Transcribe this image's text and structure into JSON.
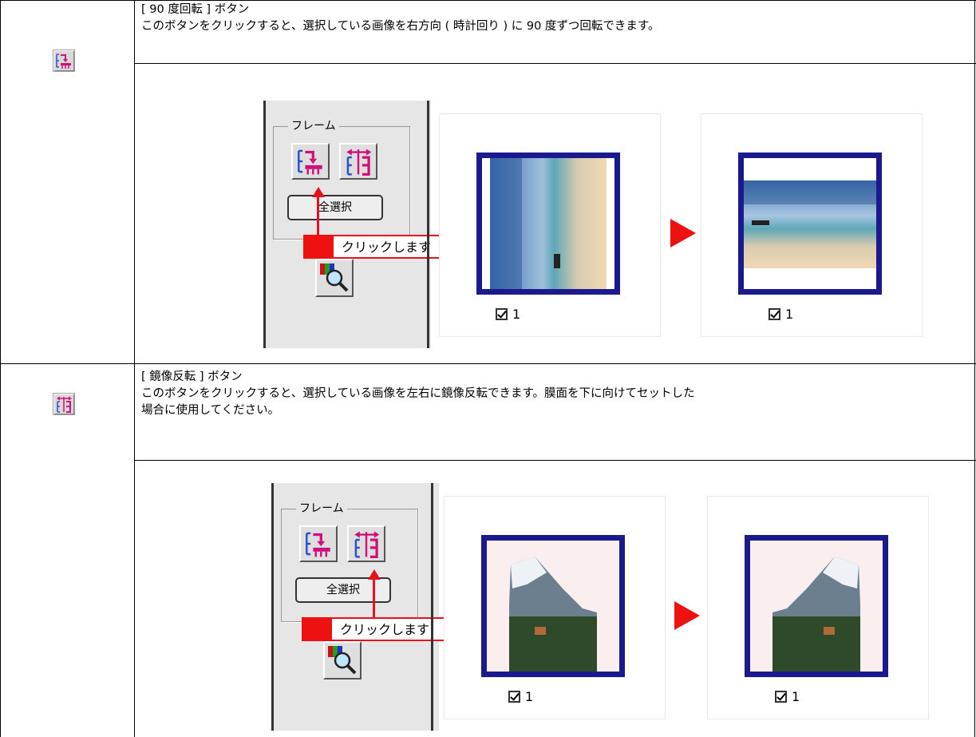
{
  "rows": [
    {
      "title": "[ 90 度回転 ] ボタン",
      "desc_lines": [
        "このボタンをクリックすると、選択している画像を右方向 ( 時計回り ) に 90 度ずつ回転できます。"
      ],
      "toolbar_icon": "rotate-90-icon",
      "illustration": {
        "panel_label": "フレーム",
        "select_all_label": "全選択",
        "callout_label": "クリックします",
        "highlighted_button": "rotate-90-button",
        "before_checkbox_number": "1",
        "after_checkbox_number": "1",
        "before_image": "portrait-beach-photo",
        "after_image": "landscape-beach-photo"
      }
    },
    {
      "title": "[ 鏡像反転 ] ボタン",
      "desc_lines": [
        "このボタンをクリックすると、選択している画像を左右に鏡像反転できます。膜面を下に向けてセットした",
        "場合に使用してください。"
      ],
      "toolbar_icon": "mirror-flip-icon",
      "illustration": {
        "panel_label": "フレーム",
        "select_all_label": "全選択",
        "callout_label": "クリックします",
        "highlighted_button": "mirror-flip-button",
        "before_checkbox_number": "1",
        "after_checkbox_number": "1",
        "before_image": "mountain-photo",
        "after_image": "mountain-photo-mirrored"
      }
    }
  ],
  "colors": {
    "accent_red": "#ee1111",
    "frame_border": "#1a1a8e",
    "icon_blue": "#2a4fd0",
    "icon_magenta": "#d0107a"
  }
}
